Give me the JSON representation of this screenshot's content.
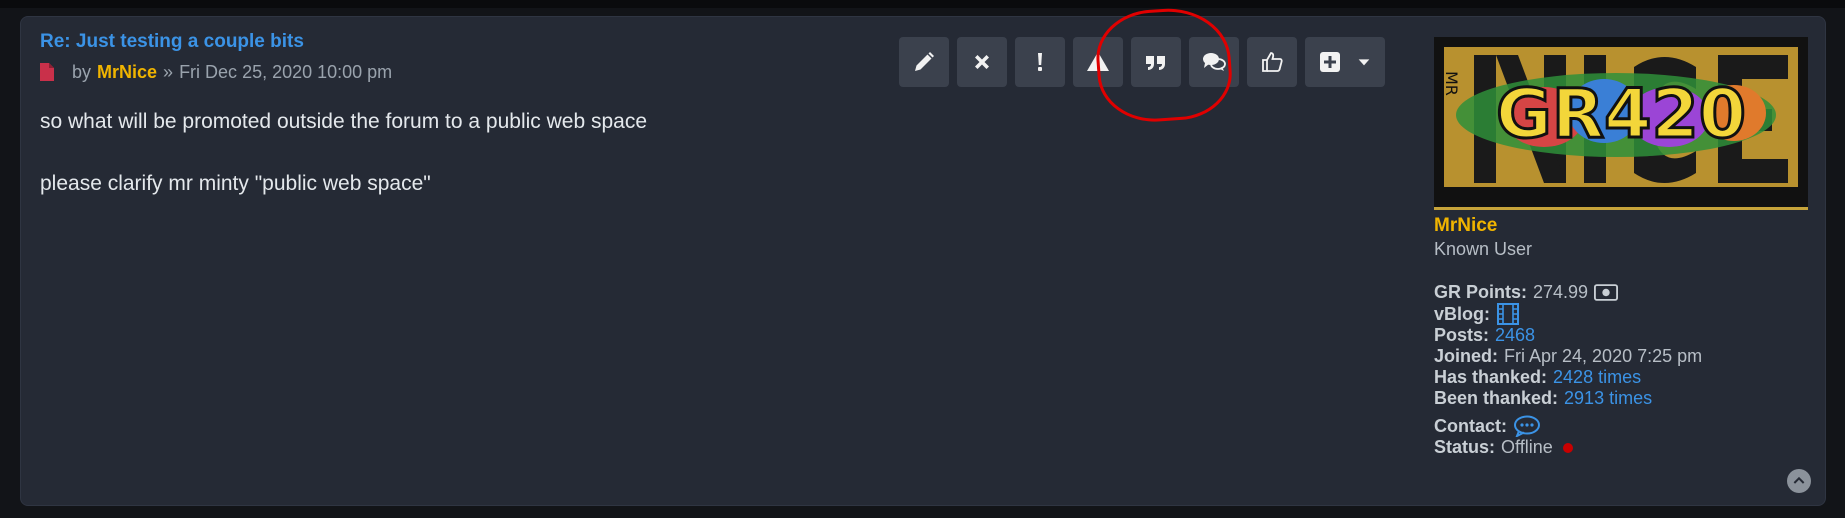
{
  "post": {
    "title": "Re: Just testing a couple bits",
    "by_label": "by",
    "author": "MrNice",
    "separator": "»",
    "date": "Fri Dec 25, 2020 10:00 pm",
    "content": [
      "so what will be promoted outside the forum to a public web space",
      "please clarify mr minty \"public web space\""
    ]
  },
  "actions": [
    {
      "name": "edit-button",
      "icon": "pencil-icon"
    },
    {
      "name": "delete-button",
      "icon": "close-icon"
    },
    {
      "name": "warn-button",
      "icon": "exclamation-icon"
    },
    {
      "name": "report-button",
      "icon": "warning-triangle-icon"
    },
    {
      "name": "quote-button",
      "icon": "quote-icon"
    },
    {
      "name": "reply-button",
      "icon": "comments-icon"
    },
    {
      "name": "thanks-button",
      "icon": "thumbs-up-icon"
    },
    {
      "name": "more-actions-button",
      "icon": "plus-square-icon"
    }
  ],
  "profile": {
    "avatar_lettering": "MR NICE GR420",
    "username": "MrNice",
    "rank": "Known User",
    "gr_points_label": "GR Points:",
    "gr_points_value": "274.99",
    "vblog_label": "vBlog:",
    "posts_label": "Posts:",
    "posts_value": "2468",
    "joined_label": "Joined:",
    "joined_value": "Fri Apr 24, 2020 7:25 pm",
    "has_thanked_label": "Has thanked:",
    "has_thanked_value": "2428 times",
    "been_thanked_label": "Been thanked:",
    "been_thanked_value": "2913 times",
    "contact_label": "Contact:",
    "status_label": "Status:",
    "status_value": "Offline"
  },
  "colors": {
    "background": "#121418",
    "panel": "#252a35",
    "link": "#3b93e6",
    "username": "#f0b400",
    "button": "#3b414d",
    "annotation": "#e00000",
    "offline": "#c90000"
  }
}
